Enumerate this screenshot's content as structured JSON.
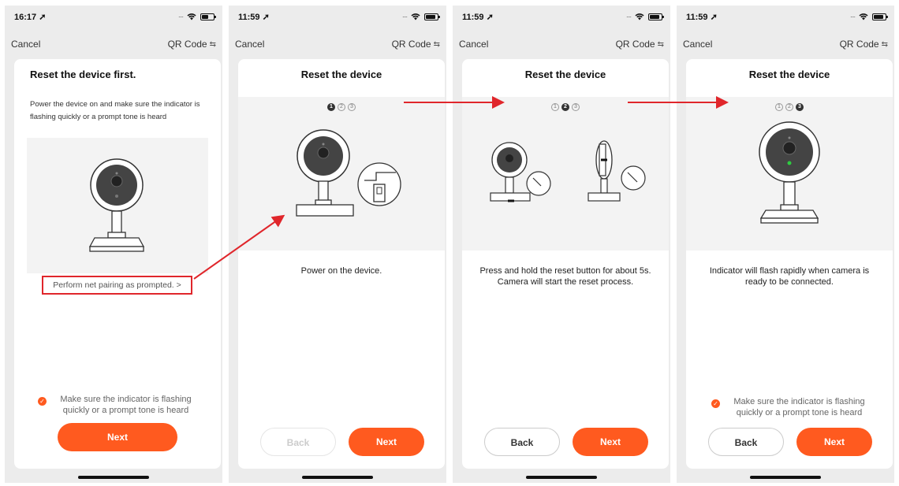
{
  "screens": [
    {
      "time": "16:17",
      "cancel": "Cancel",
      "qr": "QR Code",
      "title": "Reset the device first.",
      "intro": "Power the device on and make sure the indicator is flashing quickly or a prompt tone is heard",
      "link": "Perform net pairing as prompted. >",
      "check": "Make sure the indicator is flashing quickly or a prompt tone is heard",
      "next": "Next"
    },
    {
      "time": "11:59",
      "cancel": "Cancel",
      "qr": "QR Code",
      "title": "Reset the device",
      "steps": [
        "1",
        "2",
        "3"
      ],
      "active_step": 1,
      "desc": "Power on the device.",
      "back": "Back",
      "next": "Next"
    },
    {
      "time": "11:59",
      "cancel": "Cancel",
      "qr": "QR Code",
      "title": "Reset the device",
      "steps": [
        "1",
        "2",
        "3"
      ],
      "active_step": 2,
      "desc": "Press and hold the reset button for about 5s. Camera will start the reset process.",
      "back": "Back",
      "next": "Next"
    },
    {
      "time": "11:59",
      "cancel": "Cancel",
      "qr": "QR Code",
      "title": "Reset the device",
      "steps": [
        "1",
        "2",
        "3"
      ],
      "active_step": 3,
      "desc": "Indicator will flash rapidly when camera is ready to be connected.",
      "check": "Make sure the indicator is flashing quickly or a prompt tone is heard",
      "back": "Back",
      "next": "Next"
    }
  ],
  "colors": {
    "accent": "#ff5a1f",
    "annotation": "#e0262b"
  },
  "icons": [
    "wifi-icon",
    "battery-icon",
    "location-arrow-icon",
    "swap-icon",
    "check-icon",
    "camera-illustration",
    "usb-plug-icon",
    "reset-pin-icon"
  ]
}
